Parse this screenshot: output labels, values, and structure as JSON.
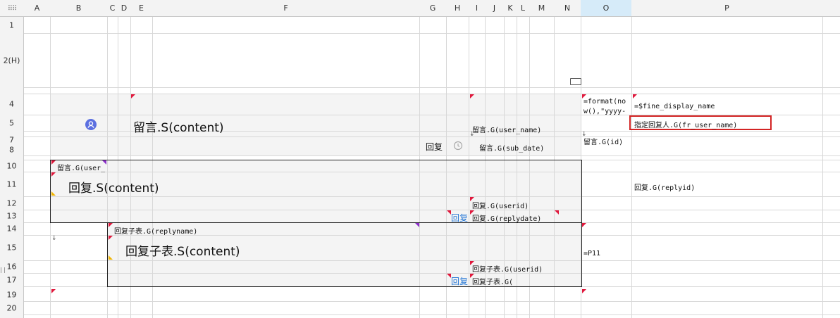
{
  "corner_icon": "grid-dots-icon",
  "columns": [
    "A",
    "B",
    "C",
    "D",
    "E",
    "F",
    "G",
    "H",
    "I",
    "J",
    "K",
    "L",
    "M",
    "N",
    "O",
    "P"
  ],
  "selected_column": "O",
  "rows": [
    "1",
    "2(H)",
    "4",
    "5",
    "7",
    "8",
    "10",
    "11",
    "12",
    "13",
    "14",
    "15",
    "16",
    "17",
    "19",
    "20"
  ],
  "cells": {
    "liuyan_content": "留言.S(content)",
    "user_name": "留言.G(user_name)",
    "reply_label": "回复",
    "sub_date": "留言.G(sub_date)",
    "format_now": "=format(no",
    "format_now_2": "w(),\"yyyy-",
    "fine_display_name": "=$fine_display_name",
    "assign_reply": "指定回复人.G(fr_user_name)",
    "liuyan_id": "留言.G(id)",
    "liuyan_user_trunc": "留言.G(user_",
    "reply_content": "回复.S(content)",
    "replyid": "回复.G(replyid)",
    "reply_userid": "回复.G(userid)",
    "reply_link": "回复",
    "reply_replydate": "回复.G(replydate)",
    "sub_replyname": "回复子表.G(replyname)",
    "sub_content": "回复子表.S(content)",
    "p11": "=P11",
    "sub_userid": "回复子表.G(userid)",
    "sub_link": "回复",
    "sub_trunc": "回复子表.G("
  },
  "icons": {
    "avatar": "user-avatar-icon",
    "history": "history-icon",
    "comment": "comment-icon"
  },
  "colors": {
    "header_bg": "#f3f3f3",
    "selected_header": "#d6ebf9",
    "flag_red": "#e0183c",
    "link_blue": "#2a7ad6",
    "highlight_border": "#d32424",
    "avatar_blue": "#5b6fe0"
  }
}
